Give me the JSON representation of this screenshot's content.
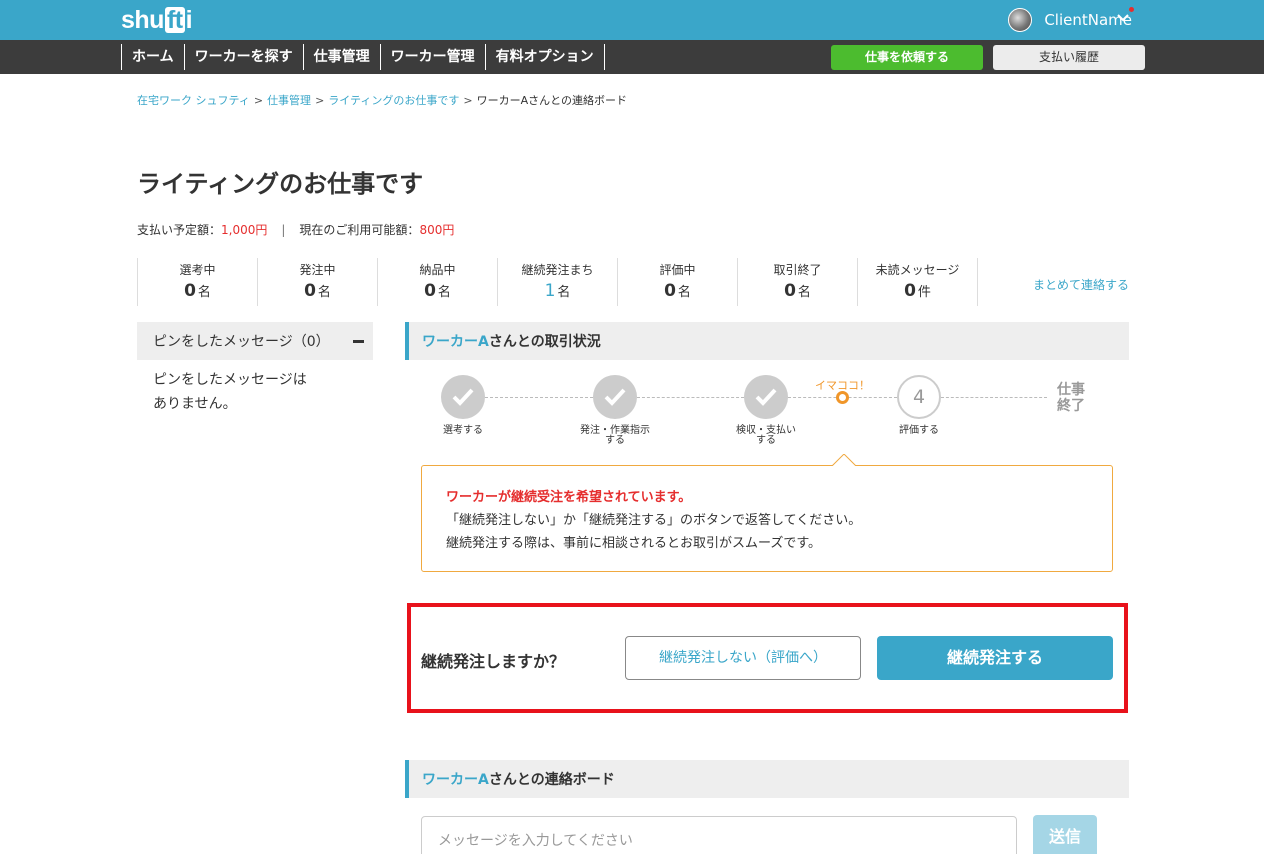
{
  "header": {
    "logo": {
      "part1": "shu",
      "part2": "ft",
      "part3": "i"
    },
    "user_name": "ClientName",
    "icons": {
      "avatar": "avatar",
      "menu": "chevron-down-icon",
      "notification": "notification-dot"
    },
    "colors": {
      "brand": "#3aa6c9",
      "nav_bg": "#3c3c3c",
      "request_button": "#4cbc2f",
      "alert": "#e52e2e",
      "accent_orange": "#f0962a"
    }
  },
  "nav": {
    "items": [
      {
        "label": "ホーム"
      },
      {
        "label": "ワーカーを探す"
      },
      {
        "label": "仕事管理"
      },
      {
        "label": "ワーカー管理"
      },
      {
        "label": "有料オプション"
      }
    ],
    "request_button": "仕事を依頼する",
    "history_button": "支払い履歴"
  },
  "breadcrumb": {
    "items": [
      {
        "label": "在宅ワーク シュフティ"
      },
      {
        "label": "仕事管理"
      },
      {
        "label": "ライティングのお仕事です"
      }
    ],
    "separator": ">",
    "current": "ワーカーAさんとの連絡ボード"
  },
  "page": {
    "title": "ライティングのお仕事です",
    "payment": {
      "planned_label": "支払い予定額：",
      "planned_value": "1,000円",
      "separator": "|",
      "available_label": "現在のご利用可能額：",
      "available_value": "800円"
    }
  },
  "stats": [
    {
      "label": "選考中",
      "value": "0",
      "unit": "名"
    },
    {
      "label": "発注中",
      "value": "0",
      "unit": "名"
    },
    {
      "label": "納品中",
      "value": "0",
      "unit": "名"
    },
    {
      "label": "継続発注まち",
      "value": "1",
      "unit": "名"
    },
    {
      "label": "評価中",
      "value": "0",
      "unit": "名"
    },
    {
      "label": "取引終了",
      "value": "0",
      "unit": "名"
    },
    {
      "label": "未読メッセージ",
      "value": "0",
      "unit": "件"
    }
  ],
  "bulk_contact": "まとめて連絡する",
  "pinned": {
    "title": "ピンをしたメッセージ（0）",
    "empty": "ピンをしたメッセージは\nありません。"
  },
  "status": {
    "worker": "ワーカーA",
    "title_suffix": "さんとの取引状況",
    "steps": [
      {
        "label": "選考する",
        "state": "done"
      },
      {
        "label": "発注・作業指示\nする",
        "state": "done"
      },
      {
        "label": "検収・支払い\nする",
        "state": "done"
      },
      {
        "label": "評価する",
        "state": "pending",
        "number": "4"
      }
    ],
    "current_marker": "イマココ！",
    "final_step": "仕事\n終了"
  },
  "notice": {
    "warning": "ワーカーが継続受注を希望されています。",
    "line1": "「継続発注しない」か「継続発注する」のボタンで返答してください。",
    "line2": "継続発注する際は、事前に相談されるとお取引がスムーズです。"
  },
  "continue": {
    "question": "継続発注しますか？",
    "no_button": "継続発注しない（評価へ）",
    "yes_button": "継続発注する"
  },
  "board": {
    "worker": "ワーカーA",
    "title_suffix": "さんとの連絡ボード",
    "placeholder": "メッセージを入力してください",
    "send": "送信"
  }
}
